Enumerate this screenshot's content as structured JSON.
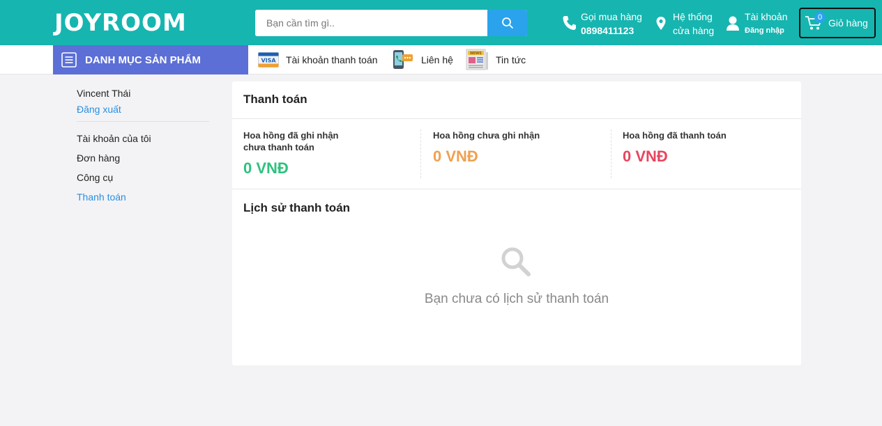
{
  "header": {
    "logo": "JOYROOM",
    "search": {
      "placeholder": "Bạn cần tìm gì..",
      "value": ""
    },
    "call": {
      "label": "Gọi mua hàng",
      "phone": "0898411123"
    },
    "store": {
      "line1": "Hệ thống",
      "line2": "cửa hàng"
    },
    "account": {
      "label": "Tài khoản",
      "sub": "Đăng nhập"
    },
    "cart": {
      "count": "0",
      "label": "Giỏ hàng"
    }
  },
  "nav": {
    "category_label": "DANH MỤC SẢN PHẨM",
    "links": [
      {
        "label": "Tài khoản thanh toán",
        "icon": "visa-card-icon"
      },
      {
        "label": "Liên hệ",
        "icon": "phone-contact-icon"
      },
      {
        "label": "Tin tức",
        "icon": "newspaper-icon"
      }
    ]
  },
  "sidebar": {
    "user_name": "Vincent Thái",
    "logout": "Đăng xuất",
    "items": [
      {
        "label": "Tài khoản của tôi",
        "active": false
      },
      {
        "label": "Đơn hàng",
        "active": false
      },
      {
        "label": "Công cụ",
        "active": false
      },
      {
        "label": "Thanh toán",
        "active": true
      }
    ]
  },
  "main": {
    "title": "Thanh toán",
    "stats": [
      {
        "label": "Hoa hồng đã ghi nhận chưa thanh toán",
        "value": "0 VNĐ",
        "color": "#2ec27e"
      },
      {
        "label": "Hoa hồng chưa ghi nhận",
        "value": "0 VNĐ",
        "color": "#f0a050"
      },
      {
        "label": "Hoa hồng đã thanh toán",
        "value": "0 VNĐ",
        "color": "#e8455e"
      }
    ],
    "history_title": "Lịch sử thanh toán",
    "empty_text": "Bạn chưa có lịch sử thanh toán"
  },
  "colors": {
    "header_bg": "#16b5b0",
    "category_bg": "#5b6fd6",
    "search_button": "#2aa3ec",
    "link_blue": "#2a8ee0"
  }
}
